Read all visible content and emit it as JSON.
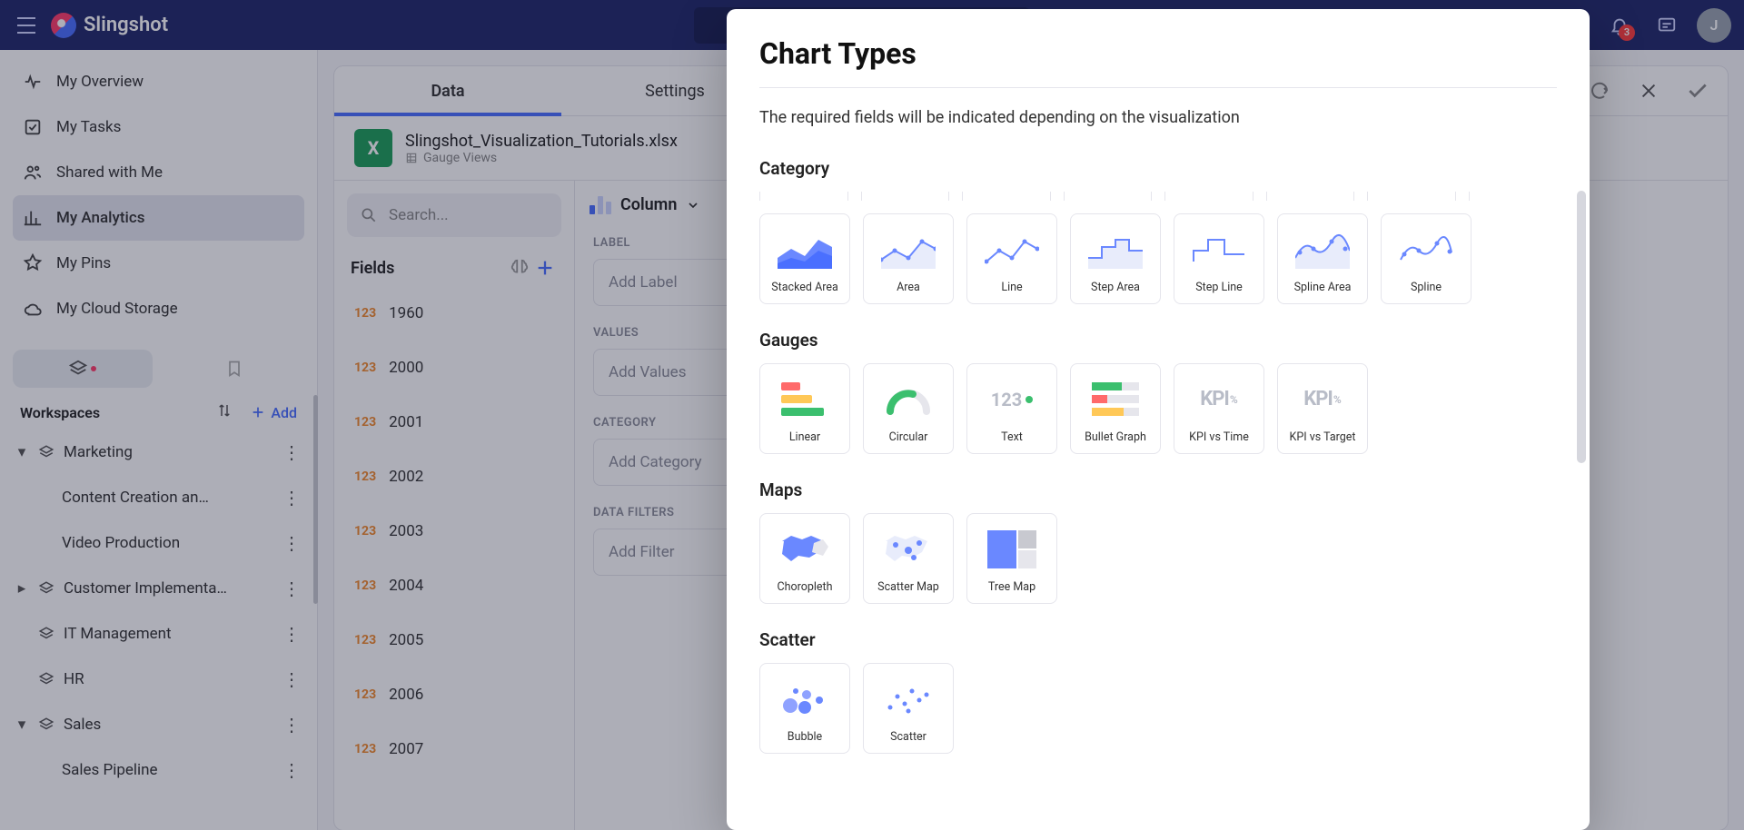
{
  "header": {
    "brand": "Slingshot",
    "notification_count": "3",
    "avatar_initial": "J"
  },
  "sidebar": {
    "items": [
      {
        "label": "My Overview"
      },
      {
        "label": "My Tasks"
      },
      {
        "label": "Shared with Me"
      },
      {
        "label": "My Analytics"
      },
      {
        "label": "My Pins"
      },
      {
        "label": "My Cloud Storage"
      }
    ],
    "workspaces_label": "Workspaces",
    "add_label": "Add",
    "tree": [
      {
        "label": "Marketing"
      },
      {
        "label": "Content Creation an…"
      },
      {
        "label": "Video Production"
      },
      {
        "label": "Customer Implementa…"
      },
      {
        "label": "IT Management"
      },
      {
        "label": "HR"
      },
      {
        "label": "Sales"
      },
      {
        "label": "Sales Pipeline"
      }
    ]
  },
  "editor": {
    "tabs": [
      {
        "label": "Data"
      },
      {
        "label": "Settings"
      }
    ],
    "source": {
      "name": "Slingshot_Visualization_Tutorials.xlsx",
      "sheet": "Gauge Views"
    },
    "search_placeholder": "Search...",
    "fields_label": "Fields",
    "fields": [
      {
        "type": "123",
        "label": "1960"
      },
      {
        "type": "123",
        "label": "2000"
      },
      {
        "type": "123",
        "label": "2001"
      },
      {
        "type": "123",
        "label": "2002"
      },
      {
        "type": "123",
        "label": "2003"
      },
      {
        "type": "123",
        "label": "2004"
      },
      {
        "type": "123",
        "label": "2005"
      },
      {
        "type": "123",
        "label": "2006"
      },
      {
        "type": "123",
        "label": "2007"
      }
    ],
    "viz_label": "Column",
    "sections": {
      "label": {
        "title": "LABEL",
        "placeholder": "Add Label"
      },
      "values": {
        "title": "VALUES",
        "placeholder": "Add Values"
      },
      "category": {
        "title": "CATEGORY",
        "placeholder": "Add Category"
      },
      "filters": {
        "title": "DATA FILTERS",
        "placeholder": "Add Filter"
      }
    }
  },
  "modal": {
    "title": "Chart Types",
    "subtitle": "The required fields will be indicated depending on the visualization",
    "groups": {
      "category": {
        "title": "Category",
        "items": [
          {
            "label": "Stacked Area"
          },
          {
            "label": "Area"
          },
          {
            "label": "Line"
          },
          {
            "label": "Step Area"
          },
          {
            "label": "Step Line"
          },
          {
            "label": "Spline Area"
          },
          {
            "label": "Spline"
          }
        ]
      },
      "gauges": {
        "title": "Gauges",
        "items": [
          {
            "label": "Linear"
          },
          {
            "label": "Circular"
          },
          {
            "label": "Text"
          },
          {
            "label": "Bullet Graph"
          },
          {
            "label": "KPI vs Time"
          },
          {
            "label": "KPI vs Target"
          }
        ]
      },
      "maps": {
        "title": "Maps",
        "items": [
          {
            "label": "Choropleth"
          },
          {
            "label": "Scatter Map"
          },
          {
            "label": "Tree Map"
          }
        ]
      },
      "scatter": {
        "title": "Scatter",
        "items": [
          {
            "label": "Bubble"
          },
          {
            "label": "Scatter"
          }
        ]
      }
    }
  }
}
